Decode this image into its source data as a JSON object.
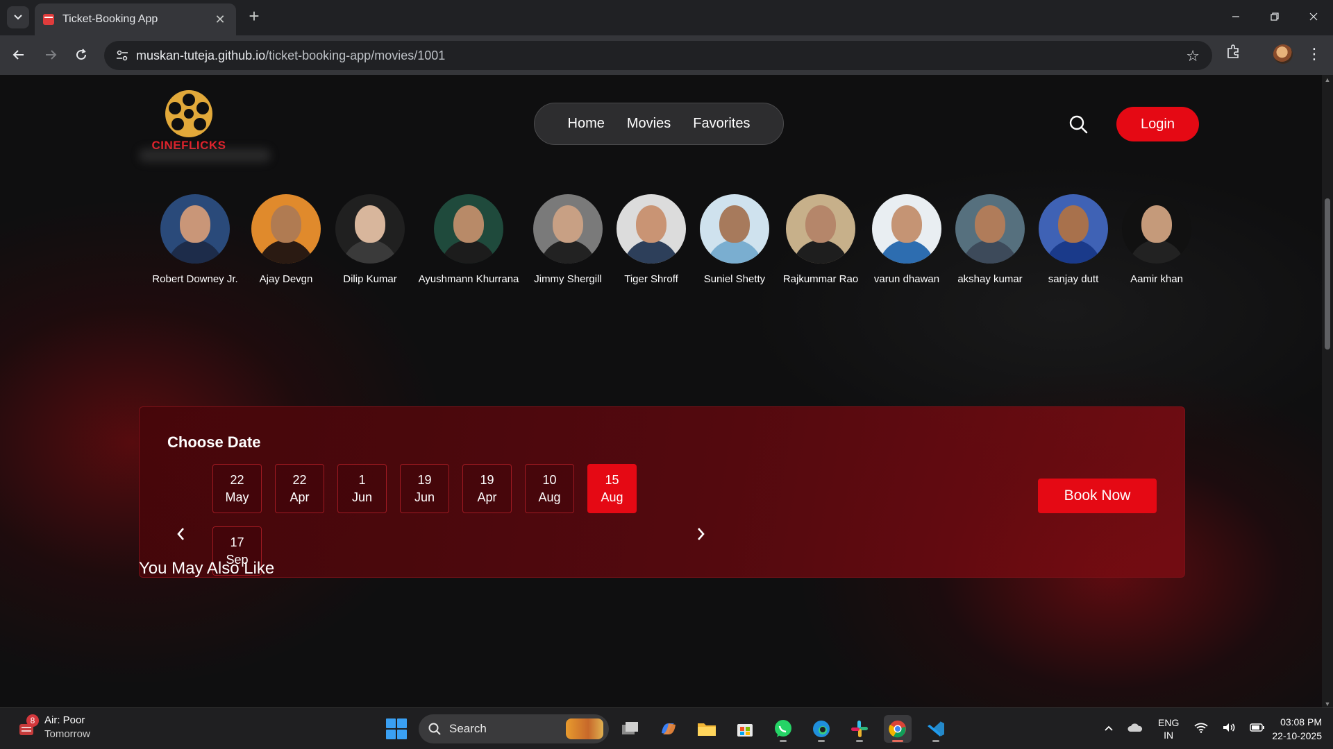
{
  "browser": {
    "tab_title": "Ticket-Booking App",
    "url_host": "muskan-tuteja.github.io",
    "url_path": "/ticket-booking-app/movies/1001"
  },
  "site": {
    "logo_text": "CINEFLICKS",
    "nav": [
      "Home",
      "Movies",
      "Favorites"
    ],
    "login_label": "Login"
  },
  "cast": [
    {
      "name": "Robert Downey Jr.",
      "skin": "#c99678",
      "shirt": "#1d2c4a",
      "bg": "#2a4a7a"
    },
    {
      "name": "Ajay Devgn",
      "skin": "#b07b52",
      "shirt": "#2a1a12",
      "bg": "#e08a2c"
    },
    {
      "name": "Dilip Kumar",
      "skin": "#d8b69c",
      "shirt": "#3a3a3a",
      "bg": "#202020"
    },
    {
      "name": "Ayushmann Khurrana",
      "skin": "#b88a68",
      "shirt": "#1c1c1c",
      "bg": "#1f4a3c"
    },
    {
      "name": "Jimmy Shergill",
      "skin": "#c8a084",
      "shirt": "#222222",
      "bg": "#7a7a7a"
    },
    {
      "name": "Tiger Shroff",
      "skin": "#c99474",
      "shirt": "#2d3f5a",
      "bg": "#dcdcdc"
    },
    {
      "name": "Suniel Shetty",
      "skin": "#a77a5c",
      "shirt": "#7aaed0",
      "bg": "#cfe2ee"
    },
    {
      "name": "Rajkummar Rao",
      "skin": "#b5866a",
      "shirt": "#1e1e1e",
      "bg": "#c7b08a"
    },
    {
      "name": "varun dhawan",
      "skin": "#c59474",
      "shirt": "#2d6db0",
      "bg": "#e9eef2"
    },
    {
      "name": "akshay kumar",
      "skin": "#b07c5a",
      "shirt": "#3d4a5a",
      "bg": "#56707e"
    },
    {
      "name": "sanjay dutt",
      "skin": "#a8714c",
      "shirt": "#1a3a8a",
      "bg": "#3f62b5"
    },
    {
      "name": "Aamir khan",
      "skin": "#c59a7a",
      "shirt": "#222222",
      "bg": "#111111"
    }
  ],
  "booking": {
    "title": "Choose Date",
    "dates": [
      {
        "day": "22",
        "month": "May",
        "selected": false
      },
      {
        "day": "22",
        "month": "Apr",
        "selected": false
      },
      {
        "day": "1",
        "month": "Jun",
        "selected": false
      },
      {
        "day": "19",
        "month": "Jun",
        "selected": false
      },
      {
        "day": "19",
        "month": "Apr",
        "selected": false
      },
      {
        "day": "10",
        "month": "Aug",
        "selected": false
      },
      {
        "day": "15",
        "month": "Aug",
        "selected": true
      },
      {
        "day": "17",
        "month": "Sep",
        "selected": false
      }
    ],
    "book_label": "Book Now"
  },
  "section": {
    "also_like": "You May Also Like"
  },
  "taskbar": {
    "weather_badge": "8",
    "weather_title": "Air: Poor",
    "weather_sub": "Tomorrow",
    "search_label": "Search",
    "lang_top": "ENG",
    "lang_bottom": "IN",
    "time": "03:08 PM",
    "date": "22-10-2025"
  },
  "colors": {
    "accent": "#e50914",
    "panel": "#5a070c"
  }
}
